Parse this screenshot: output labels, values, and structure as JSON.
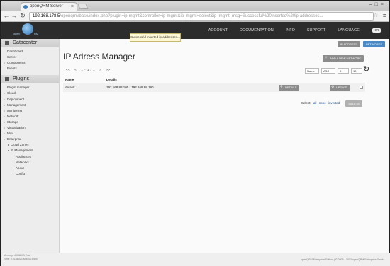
{
  "browser": {
    "tab_title": "openQRM Server",
    "url_host": "192.168.178.5",
    "url_path": "/openqrm/base/index.php?plugin=ip-mgmt&controller=ip-mgmt&ip_mgmt=select&ip_mgmt_msg=Successful%20inserted%20ip-addresses..."
  },
  "header": {
    "logo_left": "open",
    "logo_right": "RM",
    "nav": [
      "ACCOUNT",
      "DOCUMENTATION",
      "INFO",
      "SUPPORT"
    ],
    "language_label": "LANGUAGE:",
    "language_value": "en"
  },
  "notice": "Successful inserted ip-addresses...",
  "sidebar": {
    "datacenter_title": "Datacenter",
    "datacenter_items": [
      "Dashboard",
      "Server",
      "Components",
      "Events"
    ],
    "plugins_title": "Plugins",
    "plugin_items": [
      "Plugin manager",
      "Cloud",
      "Deployment",
      "Management",
      "Monitoring",
      "Network",
      "Storage",
      "Virtualization",
      "Misc",
      "Enterprise"
    ],
    "enterprise_items": [
      "Cloud Zones",
      "IP Management"
    ],
    "ipmgmt_items": [
      "Appliances",
      "Networks",
      "About",
      "Config"
    ],
    "foot_memory": "Memory: 4 098 KB Total",
    "foot_time": "Time: 0.0156021 MB/ 001 sec"
  },
  "main": {
    "btn_ip_addresses": "IP ADDRESS",
    "btn_networks": "NETWORKS",
    "title": "IP Adress Manager",
    "add_button": "ADD A NEW NETWORK",
    "pager": {
      "first": "<<",
      "prev": "<",
      "range": "1 - 1 / 1",
      "next": ">",
      "last": ">>"
    },
    "sort_select": "Name",
    "order_select": "ASC",
    "offset_value": "0",
    "limit_select": "10",
    "columns": [
      "Name",
      "Details"
    ],
    "rows": [
      {
        "name": "default",
        "details": "192.168.88.100 - 192.168.88.190",
        "details_btn": "DETAILS",
        "update_btn": "UPDATE"
      }
    ],
    "select_label": "Select:",
    "select_all": "all",
    "select_none": "none",
    "select_inverted": "inverted",
    "delete_btn": "DELETE"
  },
  "footer": {
    "copyright": "openQRM Enterprise Edition | © 2006 - 2013 openQRM Enterprise GmbH"
  }
}
